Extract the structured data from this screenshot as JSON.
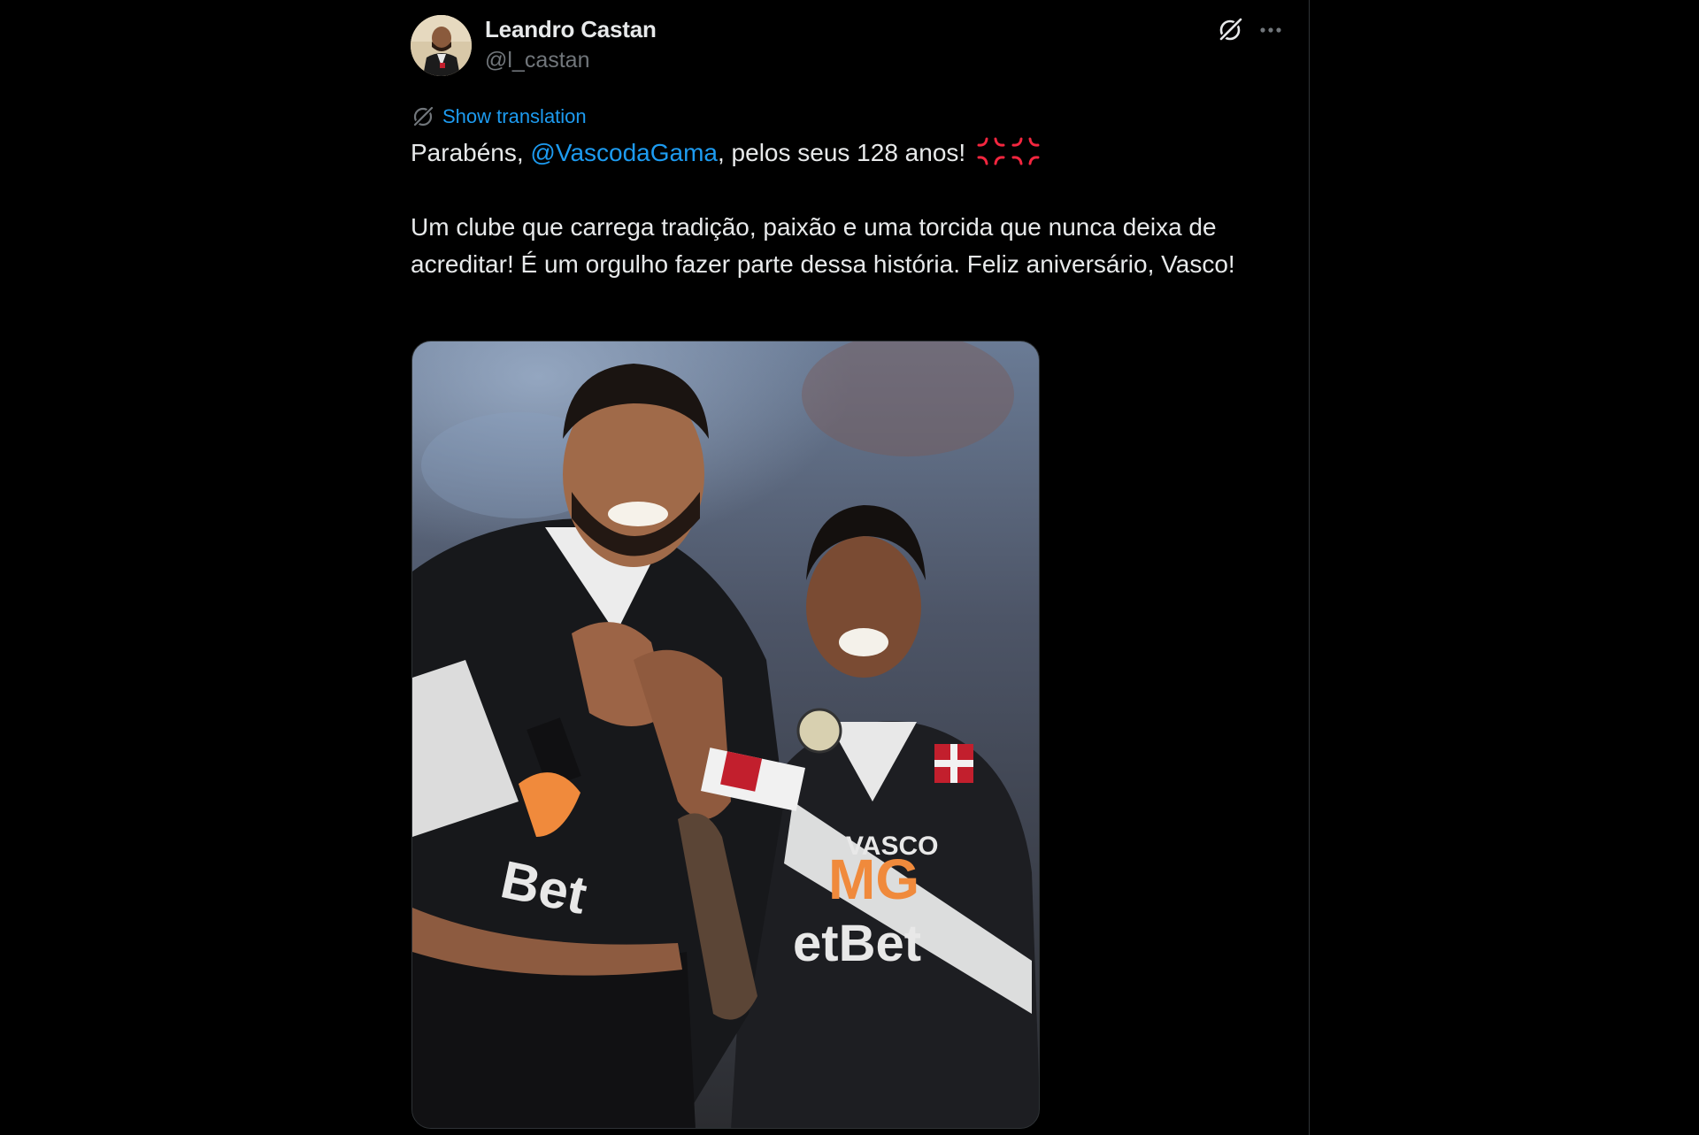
{
  "author": {
    "display_name": "Leandro Castan",
    "handle": "@l_castan",
    "avatar_icon": "profile-photo"
  },
  "header_actions": {
    "grok_icon": "grok-icon",
    "more_icon": "more-horizontal-icon"
  },
  "translation": {
    "label": "Show translation",
    "icon": "translate-icon"
  },
  "tweet": {
    "line1_prefix": "Parabéns, ",
    "mention": "@VascodaGama",
    "line1_suffix": ", pelos seus 128 anos!",
    "emoji": [
      "anger-symbol",
      "anger-symbol"
    ],
    "paragraph2": "Um clube que carrega tradição, paixão e uma torcida que nunca deixa de acreditar! É um orgulho fazer parte dessa história. Feliz aniversário, Vasco!"
  },
  "media": {
    "type": "photo",
    "jersey_words": [
      "Bet",
      "VASCO",
      "MG",
      "etBet"
    ]
  },
  "colors": {
    "background": "#000000",
    "text": "#e7e9ea",
    "secondary": "#71767b",
    "link": "#1d9bf0",
    "emoji_red": "#f4263f"
  }
}
